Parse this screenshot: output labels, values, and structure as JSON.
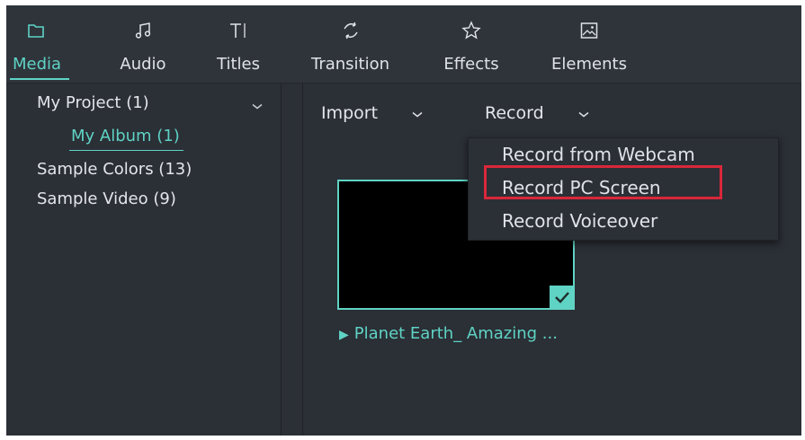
{
  "tabs": [
    {
      "label": "Media",
      "icon": "folder-icon",
      "active": true
    },
    {
      "label": "Audio",
      "icon": "music-note-icon",
      "active": false
    },
    {
      "label": "Titles",
      "icon": "text-cursor-icon",
      "active": false
    },
    {
      "label": "Transition",
      "icon": "transition-icon",
      "active": false
    },
    {
      "label": "Effects",
      "icon": "effects-icon",
      "active": false
    },
    {
      "label": "Elements",
      "icon": "image-icon",
      "active": false
    }
  ],
  "sidebar": {
    "items": [
      {
        "label": "My Project (1)"
      },
      {
        "label": "My Album (1)"
      },
      {
        "label": "Sample Colors (13)"
      },
      {
        "label": "Sample Video (9)"
      }
    ]
  },
  "toolbar": {
    "import_label": "Import",
    "record_label": "Record"
  },
  "media": {
    "clip_title": "Planet Earth_ Amazing ...",
    "selected": true
  },
  "record_menu": {
    "items": [
      {
        "label": "Record from Webcam"
      },
      {
        "label": "Record PC Screen",
        "highlighted": true
      },
      {
        "label": "Record Voiceover"
      }
    ]
  },
  "colors": {
    "accent": "#5fd3c4",
    "background": "#2b2f36",
    "highlight_border": "#d9273a"
  }
}
